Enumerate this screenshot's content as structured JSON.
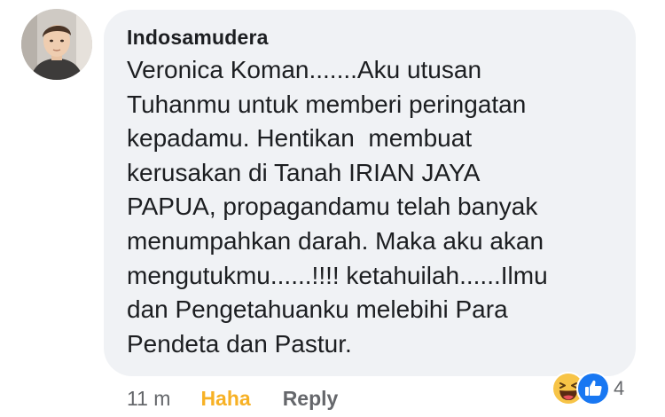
{
  "comment": {
    "author": "Indosamudera",
    "lines": [
      "Veronica Koman.......Aku utusan",
      "Tuhanmu untuk memberi peringatan",
      "kepadamu. Hentikan  membuat",
      "kerusakan di Tanah IRIAN JAYA",
      "PAPUA, propagandamu telah banyak",
      "menumpahkan darah. Maka aku akan",
      "mengutukmu......!!!! ketahuilah......Ilmu",
      "dan Pengetahuanku melebihi Para",
      "Pendeta dan Pastur."
    ]
  },
  "actions": {
    "time": "11 m",
    "reaction_label": "Haha",
    "reply_label": "Reply"
  },
  "reactions": {
    "icons": [
      "haha-emoji-icon",
      "like-thumb-icon"
    ],
    "count": "4"
  },
  "colors": {
    "bubble": "#f0f2f5",
    "text": "#1c1e21",
    "meta": "#65676b",
    "haha_active": "#f7b125",
    "like_blue": "#1877f2"
  }
}
